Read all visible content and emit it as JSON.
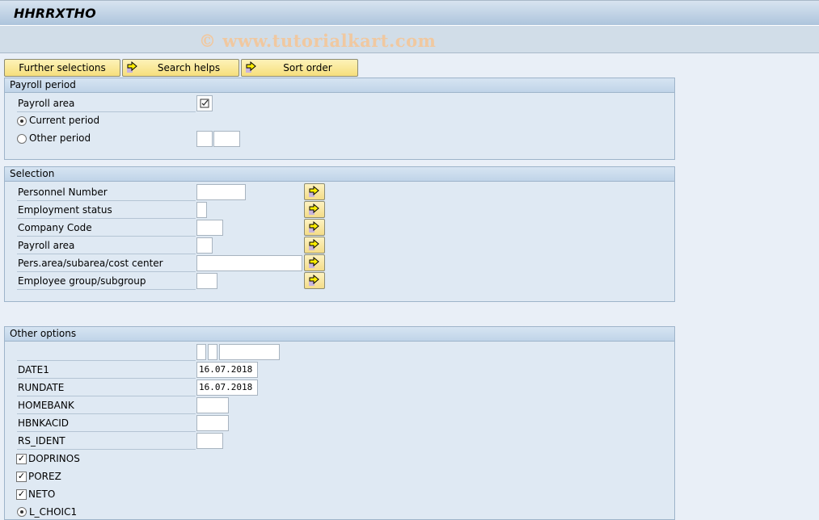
{
  "window": {
    "title": "HHRRXTHO"
  },
  "watermark": "© www.tutorialkart.com",
  "toolbar": {
    "further_selections": "Further selections",
    "search_helps": "Search helps",
    "sort_order": "Sort order"
  },
  "payroll_period": {
    "title": "Payroll period",
    "payroll_area_label": "Payroll area",
    "payroll_area_checked": true,
    "current_period_label": "Current period",
    "other_period_label": "Other period",
    "selected_period": "current",
    "other_period_value1": "",
    "other_period_value2": ""
  },
  "selection": {
    "title": "Selection",
    "fields": [
      {
        "label": "Personnel Number",
        "value": ""
      },
      {
        "label": "Employment status",
        "value": ""
      },
      {
        "label": "Company Code",
        "value": ""
      },
      {
        "label": "Payroll area",
        "value": ""
      },
      {
        "label": "Pers.area/subarea/cost center",
        "value": ""
      },
      {
        "label": "Employee group/subgroup",
        "value": ""
      }
    ]
  },
  "other_options": {
    "title": "Other options",
    "blank_row_values": [
      "",
      "",
      ""
    ],
    "fields": [
      {
        "label": "DATE1",
        "value": "16.07.2018"
      },
      {
        "label": "RUNDATE",
        "value": "16.07.2018"
      },
      {
        "label": "HOMEBANK",
        "value": ""
      },
      {
        "label": "HBNKACID",
        "value": ""
      },
      {
        "label": "RS_IDENT",
        "value": ""
      }
    ],
    "checkboxes": [
      {
        "label": "DOPRINOS",
        "checked": true
      },
      {
        "label": "POREZ",
        "checked": true
      },
      {
        "label": "NETO",
        "checked": true
      }
    ],
    "partial_radio_label": "L_CHOIC1"
  }
}
